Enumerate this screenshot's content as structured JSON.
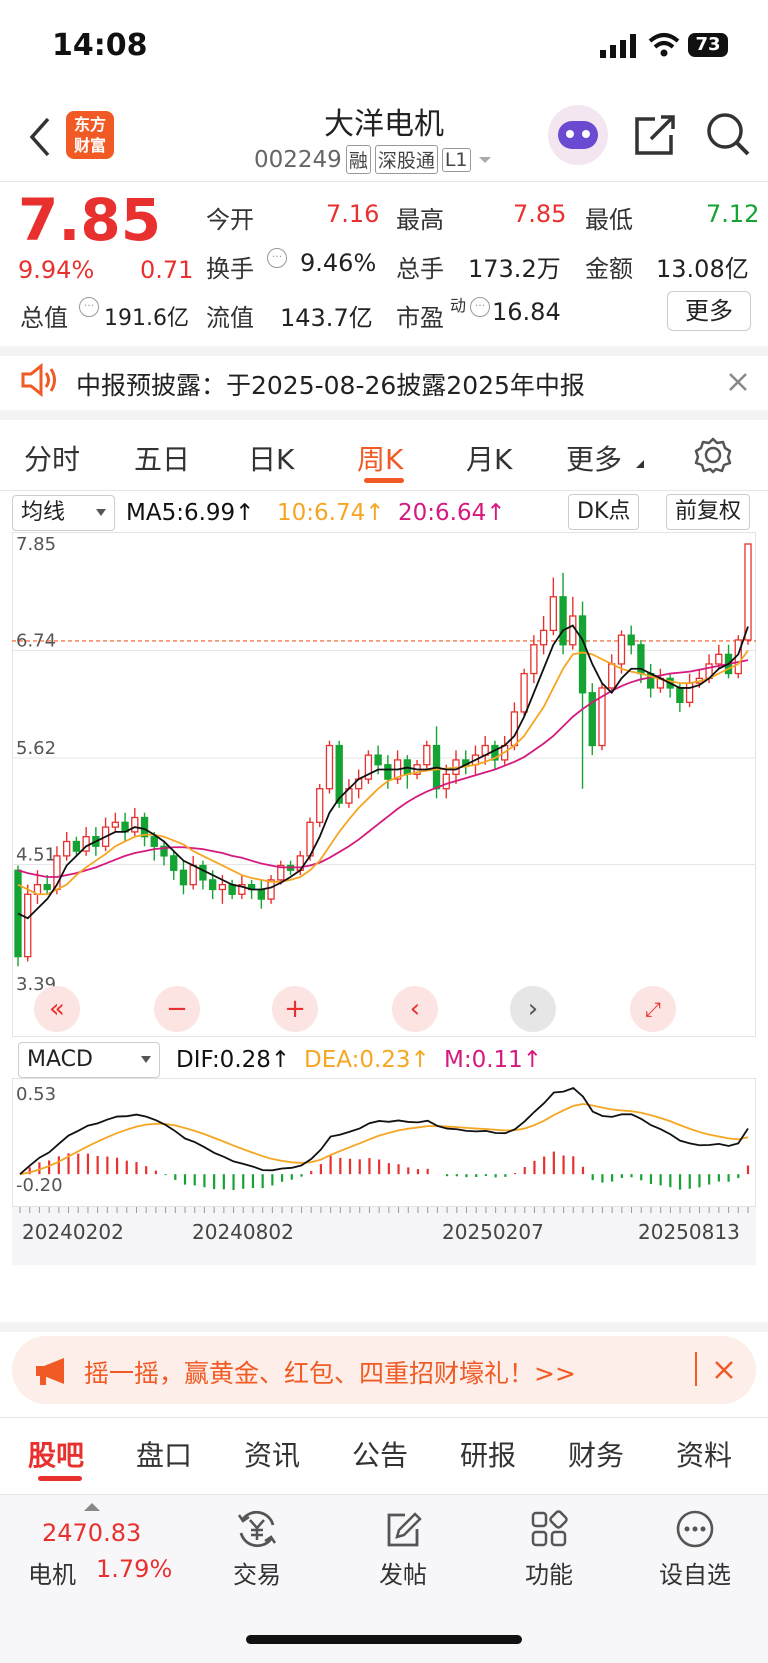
{
  "status_bar": {
    "time": "14:08",
    "battery": "73"
  },
  "header": {
    "title": "大洋电机",
    "code": "002249",
    "tags": [
      "融",
      "深股通",
      "L1"
    ],
    "logo_line1": "东方",
    "logo_line2": "财富"
  },
  "quote": {
    "price": "7.85",
    "change_pct": "9.94%",
    "change": "0.71",
    "open_label": "今开",
    "open": "7.16",
    "high_label": "最高",
    "high": "7.85",
    "low_label": "最低",
    "low": "7.12",
    "turnover_label": "换手",
    "turnover": "9.46%",
    "volume_label": "总手",
    "volume": "173.2万",
    "amount_label": "金额",
    "amount": "13.08亿",
    "mktcap_label": "总值",
    "mktcap": "191.6亿",
    "float_label": "流值",
    "float": "143.7亿",
    "pe_label": "市盈",
    "pe_sup": "动",
    "pe": "16.84",
    "more": "更多"
  },
  "notice": {
    "text": "中报预披露：于2025-08-26披露2025年中报"
  },
  "chart_tabs": [
    {
      "label": "分时",
      "active": false
    },
    {
      "label": "五日",
      "active": false
    },
    {
      "label": "日K",
      "active": false
    },
    {
      "label": "周K",
      "active": true
    },
    {
      "label": "月K",
      "active": false
    },
    {
      "label": "更多",
      "active": false
    }
  ],
  "ma_bar": {
    "select": "均线",
    "ma5": "MA5:6.99↑",
    "ma10": "10:6.74↑",
    "ma20": "20:6.64↑",
    "dk": "DK点",
    "adjust": "前复权"
  },
  "macd_bar": {
    "select": "MACD",
    "dif": "DIF:0.28↑",
    "dea": "DEA:0.23↑",
    "m": "M:0.11↑"
  },
  "colors": {
    "up": "#e8312f",
    "down": "#15a333",
    "ma5": "#111111",
    "ma10": "#f5a623",
    "ma20": "#d6197f",
    "accent": "#f15a24"
  },
  "chart_data": {
    "type": "candlestick",
    "period": "weekly",
    "y_ticks": [
      "7.85",
      "6.74",
      "5.62",
      "4.51",
      "3.39"
    ],
    "ylim": [
      3.39,
      7.85
    ],
    "current_price_line": 6.84,
    "x_ticks": [
      "20240202",
      "20240802",
      "20250207",
      "20250813"
    ],
    "macd_y_ticks": [
      "0.53",
      "-0.20"
    ],
    "macd_ylim": [
      -0.2,
      0.53
    ],
    "candles": [
      [
        4.45,
        3.55,
        4.5,
        3.45
      ],
      [
        3.55,
        4.2,
        4.3,
        3.5
      ],
      [
        4.2,
        4.3,
        4.45,
        4.1
      ],
      [
        4.3,
        4.25,
        4.4,
        4.2
      ],
      [
        4.25,
        4.6,
        4.7,
        4.2
      ],
      [
        4.6,
        4.75,
        4.85,
        4.55
      ],
      [
        4.75,
        4.65,
        4.8,
        4.6
      ],
      [
        4.65,
        4.8,
        4.9,
        4.6
      ],
      [
        4.8,
        4.7,
        4.9,
        4.6
      ],
      [
        4.7,
        4.9,
        5.0,
        4.65
      ],
      [
        4.9,
        4.95,
        5.05,
        4.85
      ],
      [
        4.95,
        4.85,
        5.05,
        4.75
      ],
      [
        4.85,
        5.0,
        5.1,
        4.8
      ],
      [
        5.0,
        4.8,
        5.05,
        4.7
      ],
      [
        4.8,
        4.7,
        4.85,
        4.55
      ],
      [
        4.7,
        4.6,
        4.75,
        4.5
      ],
      [
        4.6,
        4.45,
        4.65,
        4.35
      ],
      [
        4.45,
        4.3,
        4.55,
        4.2
      ],
      [
        4.3,
        4.5,
        4.6,
        4.25
      ],
      [
        4.5,
        4.35,
        4.55,
        4.25
      ],
      [
        4.35,
        4.25,
        4.45,
        4.15
      ],
      [
        4.25,
        4.3,
        4.4,
        4.1
      ],
      [
        4.3,
        4.2,
        4.35,
        4.15
      ],
      [
        4.2,
        4.3,
        4.4,
        4.15
      ],
      [
        4.3,
        4.25,
        4.35,
        4.15
      ],
      [
        4.25,
        4.15,
        4.35,
        4.05
      ],
      [
        4.15,
        4.35,
        4.4,
        4.1
      ],
      [
        4.35,
        4.5,
        4.55,
        4.3
      ],
      [
        4.5,
        4.45,
        4.55,
        4.4
      ],
      [
        4.45,
        4.6,
        4.65,
        4.4
      ],
      [
        4.6,
        4.95,
        5.0,
        4.55
      ],
      [
        4.95,
        5.3,
        5.35,
        4.9
      ],
      [
        5.3,
        5.75,
        5.8,
        5.25
      ],
      [
        5.75,
        5.15,
        5.8,
        5.1
      ],
      [
        5.15,
        5.3,
        5.4,
        5.1
      ],
      [
        5.3,
        5.4,
        5.5,
        5.2
      ],
      [
        5.4,
        5.65,
        5.7,
        5.35
      ],
      [
        5.65,
        5.55,
        5.75,
        5.45
      ],
      [
        5.55,
        5.4,
        5.65,
        5.3
      ],
      [
        5.4,
        5.6,
        5.7,
        5.35
      ],
      [
        5.6,
        5.45,
        5.65,
        5.3
      ],
      [
        5.45,
        5.55,
        5.6,
        5.4
      ],
      [
        5.55,
        5.75,
        5.8,
        5.5
      ],
      [
        5.75,
        5.3,
        5.95,
        5.2
      ],
      [
        5.3,
        5.45,
        5.55,
        5.2
      ],
      [
        5.45,
        5.6,
        5.7,
        5.35
      ],
      [
        5.6,
        5.55,
        5.7,
        5.45
      ],
      [
        5.55,
        5.65,
        5.75,
        5.45
      ],
      [
        5.65,
        5.75,
        5.85,
        5.55
      ],
      [
        5.75,
        5.6,
        5.8,
        5.5
      ],
      [
        5.6,
        5.75,
        5.85,
        5.55
      ],
      [
        5.75,
        6.1,
        6.2,
        5.7
      ],
      [
        6.1,
        6.5,
        6.55,
        6.05
      ],
      [
        6.5,
        6.8,
        6.9,
        6.4
      ],
      [
        6.8,
        6.95,
        7.1,
        6.7
      ],
      [
        6.95,
        7.3,
        7.5,
        6.9
      ],
      [
        7.3,
        6.8,
        7.55,
        6.7
      ],
      [
        6.8,
        7.1,
        7.3,
        6.75
      ],
      [
        7.1,
        6.3,
        7.25,
        5.3
      ],
      [
        6.3,
        5.75,
        6.4,
        5.65
      ],
      [
        5.75,
        6.35,
        6.4,
        5.7
      ],
      [
        6.35,
        6.6,
        6.7,
        6.3
      ],
      [
        6.6,
        6.9,
        6.95,
        6.5
      ],
      [
        6.9,
        6.8,
        7.0,
        6.7
      ],
      [
        6.8,
        6.5,
        6.85,
        6.4
      ],
      [
        6.5,
        6.35,
        6.6,
        6.25
      ],
      [
        6.35,
        6.45,
        6.55,
        6.3
      ],
      [
        6.45,
        6.35,
        6.5,
        6.25
      ],
      [
        6.35,
        6.2,
        6.4,
        6.1
      ],
      [
        6.2,
        6.4,
        6.5,
        6.15
      ],
      [
        6.4,
        6.45,
        6.55,
        6.35
      ],
      [
        6.45,
        6.6,
        6.7,
        6.4
      ],
      [
        6.6,
        6.7,
        6.8,
        6.55
      ],
      [
        6.7,
        6.5,
        6.8,
        6.45
      ],
      [
        6.5,
        6.85,
        6.9,
        6.45
      ],
      [
        6.85,
        7.85,
        7.85,
        6.8
      ]
    ],
    "ma5": [
      4.0,
      3.95,
      4.05,
      4.15,
      4.3,
      4.5,
      4.6,
      4.7,
      4.75,
      4.8,
      4.85,
      4.85,
      4.9,
      4.88,
      4.82,
      4.75,
      4.65,
      4.55,
      4.5,
      4.45,
      4.4,
      4.35,
      4.3,
      4.28,
      4.25,
      4.25,
      4.27,
      4.32,
      4.38,
      4.45,
      4.6,
      4.8,
      5.05,
      5.2,
      5.3,
      5.4,
      5.45,
      5.5,
      5.5,
      5.5,
      5.52,
      5.5,
      5.5,
      5.52,
      5.5,
      5.5,
      5.55,
      5.6,
      5.65,
      5.7,
      5.75,
      5.85,
      6.05,
      6.3,
      6.55,
      6.8,
      6.95,
      7.0,
      6.85,
      6.6,
      6.4,
      6.3,
      6.45,
      6.55,
      6.55,
      6.5,
      6.45,
      6.4,
      6.35,
      6.35,
      6.38,
      6.45,
      6.55,
      6.6,
      6.7,
      6.99
    ],
    "ma10": [
      4.3,
      4.25,
      4.2,
      4.2,
      4.25,
      4.3,
      4.4,
      4.48,
      4.55,
      4.62,
      4.7,
      4.75,
      4.8,
      4.82,
      4.82,
      4.8,
      4.76,
      4.72,
      4.65,
      4.6,
      4.55,
      4.5,
      4.45,
      4.4,
      4.37,
      4.35,
      4.33,
      4.33,
      4.35,
      4.38,
      4.45,
      4.55,
      4.7,
      4.85,
      4.98,
      5.1,
      5.2,
      5.3,
      5.38,
      5.42,
      5.45,
      5.47,
      5.49,
      5.5,
      5.51,
      5.52,
      5.53,
      5.55,
      5.58,
      5.62,
      5.68,
      5.75,
      5.85,
      6.0,
      6.15,
      6.35,
      6.55,
      6.7,
      6.72,
      6.7,
      6.65,
      6.6,
      6.55,
      6.52,
      6.5,
      6.47,
      6.44,
      6.42,
      6.4,
      6.4,
      6.42,
      6.45,
      6.5,
      6.55,
      6.6,
      6.74
    ],
    "ma20": [
      4.45,
      4.42,
      4.4,
      4.38,
      4.38,
      4.4,
      4.42,
      4.45,
      4.48,
      4.52,
      4.56,
      4.6,
      4.63,
      4.65,
      4.67,
      4.68,
      4.69,
      4.69,
      4.68,
      4.67,
      4.65,
      4.63,
      4.6,
      4.58,
      4.55,
      4.52,
      4.5,
      4.48,
      4.48,
      4.48,
      4.5,
      4.53,
      4.58,
      4.64,
      4.7,
      4.77,
      4.85,
      4.93,
      5.01,
      5.09,
      5.16,
      5.22,
      5.27,
      5.31,
      5.35,
      5.38,
      5.41,
      5.44,
      5.47,
      5.5,
      5.54,
      5.58,
      5.63,
      5.7,
      5.77,
      5.85,
      5.95,
      6.05,
      6.13,
      6.2,
      6.26,
      6.32,
      6.37,
      6.41,
      6.44,
      6.46,
      6.48,
      6.5,
      6.51,
      6.52,
      6.54,
      6.56,
      6.58,
      6.6,
      6.62,
      6.64
    ]
  },
  "bottom_tabs": [
    {
      "label": "股吧",
      "active": true
    },
    {
      "label": "盘口",
      "active": false
    },
    {
      "label": "资讯",
      "active": false
    },
    {
      "label": "公告",
      "active": false
    },
    {
      "label": "研报",
      "active": false
    },
    {
      "label": "财务",
      "active": false
    },
    {
      "label": "资料",
      "active": false
    }
  ],
  "banner": {
    "text": "摇一摇，赢黄金、红包、四重招财壕礼！>>"
  },
  "bottom_bar": {
    "index_value": "2470.83",
    "index_name": "电机",
    "index_pct": "1.79%",
    "trade": "交易",
    "post": "发帖",
    "function": "功能",
    "watchlist": "设自选"
  }
}
